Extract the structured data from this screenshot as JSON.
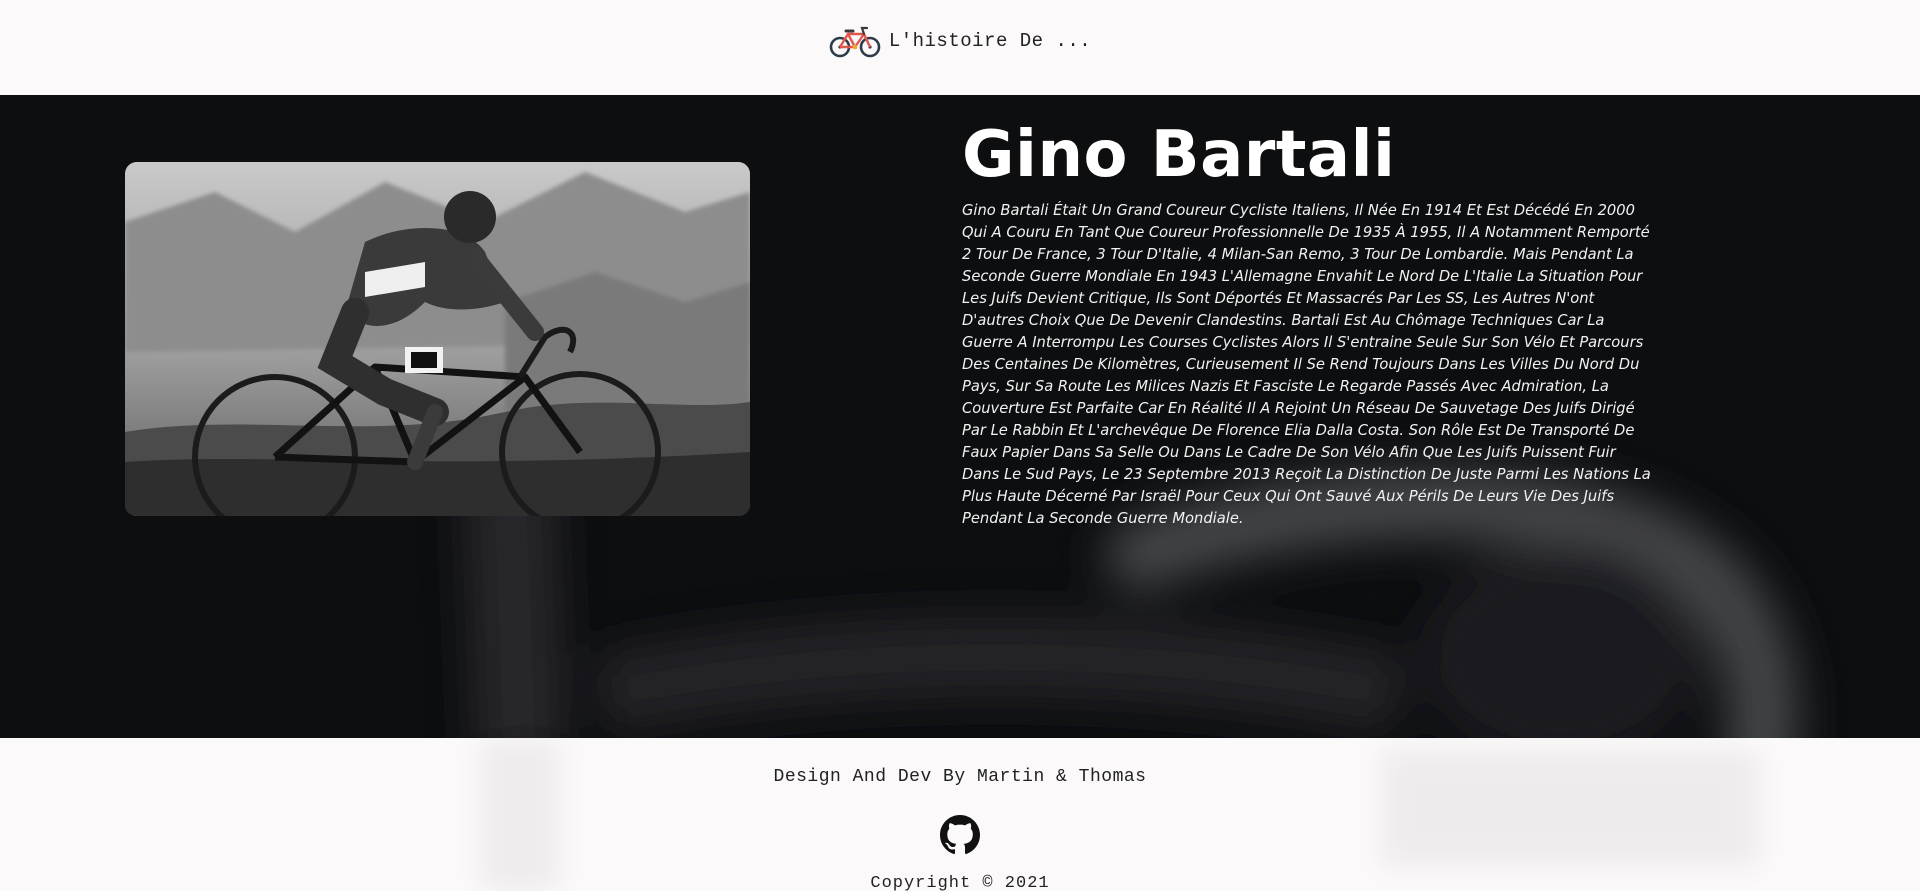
{
  "header": {
    "brand_icon": "bicycle-icon",
    "title": "L'histoire De ..."
  },
  "hero": {
    "background_image": "blurred-bicycle-handlebar",
    "photo": "gino-bartali-cycling-photo",
    "name": "Gino Bartali",
    "biography": "Gino Bartali Était Un Grand Coureur Cycliste Italiens, Il Née En 1914 Et Est Décédé En 2000 Qui A Couru En Tant Que Coureur Professionnelle De 1935 À 1955, Il A Notamment Remporté 2 Tour De France, 3 Tour D'Italie, 4 Milan-San Remo, 3 Tour De Lombardie. Mais Pendant La Seconde Guerre Mondiale En 1943 L'Allemagne Envahit Le Nord De L'Italie La Situation Pour Les Juifs Devient Critique, Ils Sont Déportés Et Massacrés Par Les SS, Les Autres N'ont D'autres Choix Que De Devenir Clandestins. Bartali Est Au Chômage Techniques Car La Guerre A Interrompu Les Courses Cyclistes Alors Il S'entraine Seule Sur Son Vélo Et Parcours Des Centaines De Kilomètres, Curieusement Il Se Rend Toujours Dans Les Villes Du Nord Du Pays, Sur Sa Route Les Milices Nazis Et Fasciste Le Regarde Passés Avec Admiration, La Couverture Est Parfaite Car En Réalité Il A Rejoint Un Réseau De Sauvetage Des Juifs Dirigé Par Le Rabbin Et L'archevêque De Florence Elia Dalla Costa. Son Rôle Est De Transporté De Faux Papier Dans Sa Selle Ou Dans Le Cadre De Son Vélo Afin Que Les Juifs Puissent Fuir Dans Le Sud Pays, Le 23 Septembre 2013 Reçoit La Distinction De Juste Parmi Les Nations La Plus Haute Décerné Par Israël Pour Ceux Qui Ont Sauvé Aux Périls De Leurs Vie Des Juifs Pendant La Seconde Guerre Mondiale."
  },
  "footer": {
    "credit": "Design And Dev By Martin & Thomas",
    "github_icon": "github-icon",
    "copyright": "Copyright © 2021"
  },
  "colors": {
    "page_background": "#fbf9f9",
    "hero_background": "#0d0e10",
    "hero_text": "#ffffff",
    "footer_text": "#222222"
  }
}
